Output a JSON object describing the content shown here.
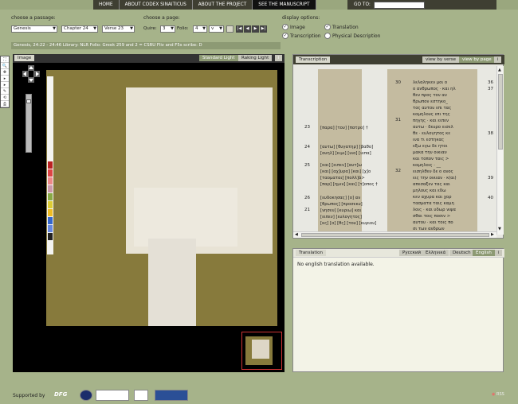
{
  "nav": {
    "items": [
      "HOME",
      "ABOUT CODEX SINAITICUS",
      "ABOUT THE PROJECT",
      "SEE THE MANUSCRIPT"
    ],
    "active": "SEE THE MANUSCRIPT",
    "goto_label": "GO TO:",
    "goto_value": "(BOOK)"
  },
  "passage": {
    "label": "choose a passage:",
    "book": "Genesis",
    "chapter": "Chapter 24",
    "verse": "Verse 23"
  },
  "page_choice": {
    "label": "choose a page:",
    "quire_label": "Quire:",
    "quire_value": "3",
    "folio_label": "Folio:",
    "folio_value": "4",
    "side_value": "v"
  },
  "display": {
    "label": "display options:",
    "image": "Image",
    "transcription": "Transcription",
    "translation": "Translation",
    "physical": "Physical Description"
  },
  "passage_info": "Genesis, 24:22 - 24:46  Library: NLR  Folio: Greek 259 and 2 = CSRU Fliv and F5s  scribe: D",
  "image_panel": {
    "title": "Image",
    "tab_standard": "Standard Light",
    "tab_raking": "Raking Light",
    "info": "i"
  },
  "transcription_panel": {
    "title": "Transcription",
    "tab_verse": "view by verse",
    "tab_page": "view by page",
    "info": "i",
    "left_verses": [
      "23",
      "24",
      "25",
      "26",
      "21"
    ],
    "left_lines": [
      "[παρα] [του] [πατρο] †",
      "[αυτω] [θυγατηρ] [βαθο]",
      "[ουηλ] [ειμι] [υιο] [ιεπα]",
      "[και] [ειπεν] [αυτ]ω",
      "[και] [αχ]υρα] [και] [χ]ο",
      "[ταομαται] [πολλ]ά>",
      "[παρ] [ημιν] [και] [τ]οπος †",
      "[ευδοκησας] [ο] αν",
      "[θρωπος] [προσεκυ]",
      "[νησεν] [κυριω] και",
      "[ειπεν] [ευλογητος]",
      "[κς] [ο] [θς] [του] [κυριου]"
    ],
    "right_verses": [
      "30",
      "31",
      "32"
    ],
    "right_verse_side": [
      "36",
      "37",
      "38",
      "39",
      "40"
    ],
    "right_lines": [
      "λελαληκεν μοι ο",
      "ο ανθρωπος · και ηλ",
      "θεν προς τον αν",
      "θρωπον εστηκο_",
      "τος αυτου επι τας",
      "καμηλους επι της",
      "πηγης · και ειπεν",
      "αυτω · δευρο εισελ",
      "θε · ευλογητος κε",
      "ινα τι εστηκας",
      "εξω εγω δε ητοι",
      "μακα την οικιαν",
      "και τοπον ταις >",
      "καμηλοις · __",
      "εισηλθεν δε ο ανος",
      "εις την οικιαν · κ(αι)",
      "απεσαξεν τας και",
      "μηλους και εδω",
      "κεν αχυρα και χορ",
      "τασματα ταις καμη",
      "λοις · και υδωρ νιψα",
      "σθαι τοις ποσιν >",
      "αυτου · και τοις πο",
      "σι των ανδρων"
    ]
  },
  "translation_panel": {
    "title": "Translation",
    "langs": [
      "Русский",
      "Ελληνικά",
      "Deutsch",
      "English"
    ],
    "active_lang": "English",
    "info": "i",
    "message": "No english translation available."
  },
  "footer": {
    "supported_by": "Supported by",
    "dfg": "DFG",
    "rss": "RSS"
  }
}
